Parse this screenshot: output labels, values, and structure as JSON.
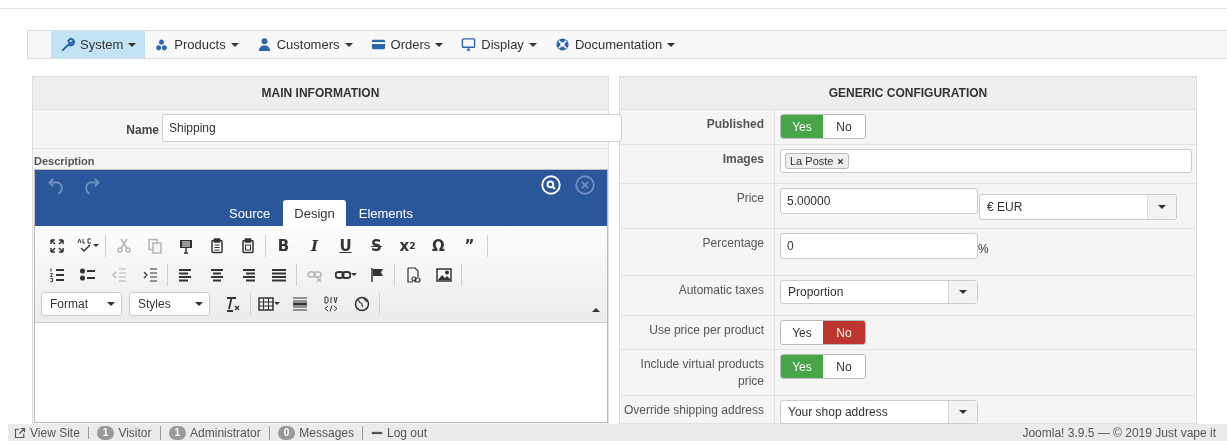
{
  "menu": [
    {
      "label": "System",
      "selected": true
    },
    {
      "label": "Products",
      "selected": false
    },
    {
      "label": "Customers",
      "selected": false
    },
    {
      "label": "Orders",
      "selected": false
    },
    {
      "label": "Display",
      "selected": false
    },
    {
      "label": "Documentation",
      "selected": false
    }
  ],
  "main_panel": {
    "title": "MAIN INFORMATION",
    "name_label": "Name",
    "name_value": "Shipping",
    "description_label": "Description",
    "editor": {
      "history": [
        {
          "disabled": true
        },
        {
          "disabled": true
        }
      ],
      "tabs": [
        {
          "label": "Source",
          "selected": false
        },
        {
          "label": "Design",
          "selected": true
        },
        {
          "label": "Elements",
          "selected": false
        }
      ],
      "toolbar": [
        [
          [
            {
              "kind": "icon",
              "disabled": false
            },
            {
              "kind": "icon",
              "disabled": false
            }
          ],
          [
            {
              "kind": "icon",
              "disabled": true
            },
            {
              "kind": "icon",
              "disabled": true
            },
            {
              "kind": "icon",
              "disabled": false
            },
            {
              "kind": "icon",
              "disabled": false
            },
            {
              "kind": "icon",
              "disabled": false
            }
          ],
          [
            {
              "kind": "glyph",
              "text": "B",
              "disabled": false
            },
            {
              "kind": "glyph",
              "text": "I",
              "disabled": false
            },
            {
              "kind": "glyph",
              "text": "U",
              "disabled": false
            },
            {
              "kind": "glyph",
              "text": "S",
              "disabled": false
            },
            {
              "kind": "glyph",
              "text": "x$^{2}$",
              "disabled": false
            },
            {
              "kind": "glyph",
              "text": "Ω",
              "disabled": false
            },
            {
              "kind": "glyph",
              "text": "”",
              "disabled": false
            }
          ]
        ],
        [
          [
            {
              "kind": "icon",
              "disabled": false
            },
            {
              "kind": "icon",
              "disabled": false
            },
            {
              "kind": "icon",
              "disabled": true
            },
            {
              "kind": "icon",
              "disabled": false
            }
          ],
          [
            {
              "kind": "icon",
              "disabled": false
            },
            {
              "kind": "icon",
              "disabled": false
            },
            {
              "kind": "icon",
              "disabled": false
            },
            {
              "kind": "icon",
              "disabled": false
            }
          ],
          [
            {
              "kind": "icon",
              "disabled": true
            },
            {
              "kind": "icon",
              "disabled": false
            },
            {
              "kind": "icon",
              "disabled": false
            }
          ],
          [
            {
              "kind": "icon",
              "disabled": false
            },
            {
              "kind": "icon",
              "disabled": false
            }
          ]
        ],
        [
          [
            {
              "kind": "select",
              "text": "Format",
              "disabled": false
            },
            {
              "kind": "select",
              "text": "Styles",
              "disabled": false
            },
            {
              "kind": "icon",
              "disabled": false
            }
          ],
          [
            {
              "kind": "icon",
              "disabled": false
            },
            {
              "kind": "icon",
              "disabled": false
            },
            {
              "kind": "icon",
              "disabled": false
            },
            {
              "kind": "icon",
              "disabled": false
            }
          ]
        ]
      ]
    }
  },
  "config_panel": {
    "title": "GENERIC CONFIGURATION",
    "rows": [
      {
        "kind": "toggle",
        "label": "Published",
        "highlighted": true,
        "options": [
          {
            "label": "Yes",
            "selected": true
          },
          {
            "label": "No",
            "selected": false
          }
        ]
      },
      {
        "kind": "tags",
        "label": "Images",
        "highlighted": true,
        "tags": [
          "La Poste"
        ]
      },
      {
        "kind": "price",
        "label": "Price",
        "highlighted": false,
        "value": "5.00000",
        "currency": "€ EUR"
      },
      {
        "kind": "percent",
        "label": "Percentage",
        "highlighted": false,
        "value": "0",
        "suffix": "%"
      },
      {
        "kind": "select",
        "label": "Automatic taxes",
        "highlighted": false,
        "value": "Proportion"
      },
      {
        "kind": "toggle",
        "label": "Use price per product",
        "highlighted": false,
        "options": [
          {
            "label": "Yes",
            "selected": false
          },
          {
            "label": "No",
            "selected": true
          }
        ]
      },
      {
        "kind": "toggle",
        "label": "Include virtual products price",
        "highlighted": false,
        "options": [
          {
            "label": "Yes",
            "selected": true
          },
          {
            "label": "No",
            "selected": false
          }
        ]
      },
      {
        "kind": "select",
        "label": "Override shipping address",
        "highlighted": false,
        "value": "Your shop address"
      }
    ]
  },
  "status_bar": {
    "items": [
      {
        "kind": "link",
        "label": "View Site"
      },
      {
        "kind": "count",
        "count": "1",
        "label": "Visitor"
      },
      {
        "kind": "count",
        "count": "1",
        "label": "Administrator"
      },
      {
        "kind": "count",
        "count": "0",
        "label": "Messages"
      },
      {
        "kind": "logout",
        "label": "Log out"
      }
    ],
    "copyright": "Joomla! 3.9.5 — © 2019 Just vape it"
  }
}
